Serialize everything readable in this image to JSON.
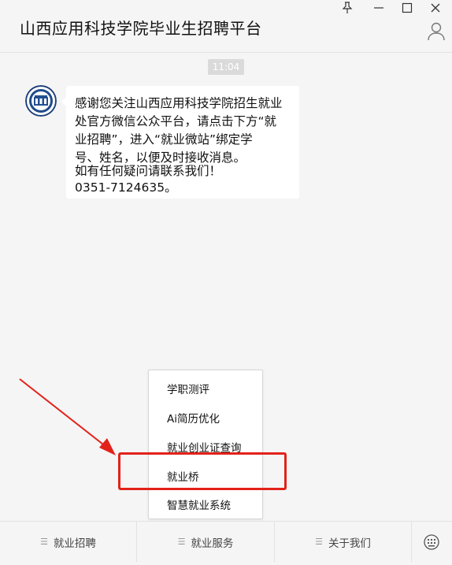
{
  "window": {
    "title": "山西应用科技学院毕业生招聘平台",
    "controls": [
      "pin-icon",
      "minimize-icon",
      "maximize-icon",
      "close-icon"
    ]
  },
  "chat": {
    "timestamp": "11:04",
    "message_lines": [
      "感谢您关注山西应用科技学院招生就业",
      "处官方微信公众平台，请点击下方“就",
      "业招聘”，进入“就业微站”绑定学",
      "号、姓名，以便及时接收消息。",
      "如有任何疑问请联系我们！",
      "0351-7124635。"
    ]
  },
  "popup_menu": {
    "items": [
      "学职测评",
      "Ai简历优化",
      "就业创业证查询",
      "就业桥",
      "智慧就业系统"
    ],
    "highlighted_item": "就业桥"
  },
  "bottom_menu": {
    "tabs": [
      "就业招聘",
      "就业服务",
      "关于我们"
    ]
  },
  "colors": {
    "background": "#f5f5f5",
    "bubble": "#ffffff",
    "highlight": "#e2221a",
    "timestamp_bg": "#dadada"
  }
}
